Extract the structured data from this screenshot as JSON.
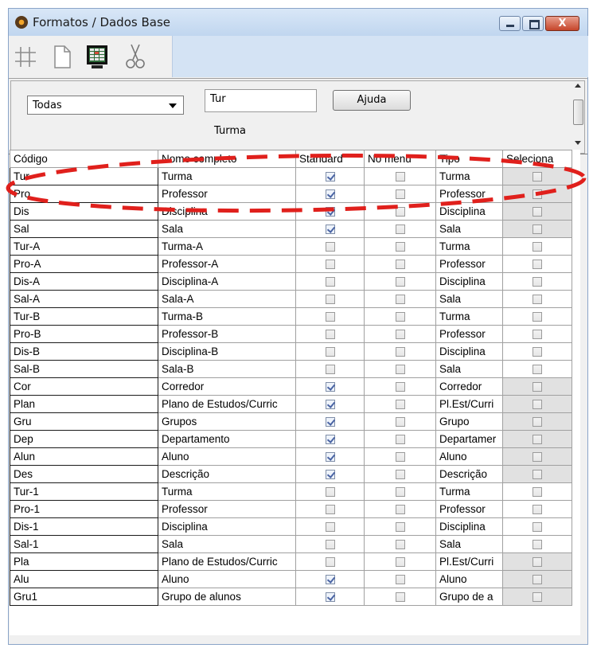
{
  "window": {
    "title": "Formatos / Dados Base",
    "close_label": "X"
  },
  "toolbar": {
    "tools": [
      "grid-icon",
      "new-document-icon",
      "table-view-icon",
      "cut-icon"
    ]
  },
  "filters": {
    "dropdown_value": "Todas",
    "input_value": "Tur",
    "help_button": "Ajuda",
    "full_name_label": "Turma"
  },
  "grid": {
    "columns": [
      "Código",
      "Nome completo",
      "Standard",
      "No menu",
      "Tipo",
      "Seleciona"
    ],
    "rows": [
      {
        "code": "Tur",
        "name": "Turma",
        "standard": true,
        "nomenu": false,
        "tipo": "Turma",
        "sel_shaded": true
      },
      {
        "code": "Pro",
        "name": "Professor",
        "standard": true,
        "nomenu": false,
        "tipo": "Professor",
        "sel_shaded": true
      },
      {
        "code": "Dis",
        "name": "Disciplina",
        "standard": true,
        "nomenu": false,
        "tipo": "Disciplina",
        "sel_shaded": true
      },
      {
        "code": "Sal",
        "name": "Sala",
        "standard": true,
        "nomenu": false,
        "tipo": "Sala",
        "sel_shaded": true
      },
      {
        "code": "Tur-A",
        "name": "Turma-A",
        "standard": false,
        "nomenu": false,
        "tipo": "Turma",
        "sel_shaded": false
      },
      {
        "code": "Pro-A",
        "name": "Professor-A",
        "standard": false,
        "nomenu": false,
        "tipo": "Professor",
        "sel_shaded": false
      },
      {
        "code": "Dis-A",
        "name": "Disciplina-A",
        "standard": false,
        "nomenu": false,
        "tipo": "Disciplina",
        "sel_shaded": false
      },
      {
        "code": "Sal-A",
        "name": "Sala-A",
        "standard": false,
        "nomenu": false,
        "tipo": "Sala",
        "sel_shaded": false
      },
      {
        "code": "Tur-B",
        "name": "Turma-B",
        "standard": false,
        "nomenu": false,
        "tipo": "Turma",
        "sel_shaded": false
      },
      {
        "code": "Pro-B",
        "name": "Professor-B",
        "standard": false,
        "nomenu": false,
        "tipo": "Professor",
        "sel_shaded": false
      },
      {
        "code": "Dis-B",
        "name": "Disciplina-B",
        "standard": false,
        "nomenu": false,
        "tipo": "Disciplina",
        "sel_shaded": false
      },
      {
        "code": "Sal-B",
        "name": "Sala-B",
        "standard": false,
        "nomenu": false,
        "tipo": "Sala",
        "sel_shaded": false
      },
      {
        "code": "Cor",
        "name": "Corredor",
        "standard": true,
        "nomenu": false,
        "tipo": "Corredor",
        "sel_shaded": true
      },
      {
        "code": "Plan",
        "name": "Plano de Estudos/Curric",
        "standard": true,
        "nomenu": false,
        "tipo": "Pl.Est/Curri",
        "sel_shaded": true
      },
      {
        "code": "Gru",
        "name": "Grupos",
        "standard": true,
        "nomenu": false,
        "tipo": "Grupo",
        "sel_shaded": true
      },
      {
        "code": "Dep",
        "name": "Departamento",
        "standard": true,
        "nomenu": false,
        "tipo": "Departamer",
        "sel_shaded": true
      },
      {
        "code": "Alun",
        "name": "Aluno",
        "standard": true,
        "nomenu": false,
        "tipo": "Aluno",
        "sel_shaded": true
      },
      {
        "code": "Des",
        "name": "Descrição",
        "standard": true,
        "nomenu": false,
        "tipo": "Descrição",
        "sel_shaded": true
      },
      {
        "code": "Tur-1",
        "name": "Turma",
        "standard": false,
        "nomenu": false,
        "tipo": "Turma",
        "sel_shaded": false
      },
      {
        "code": "Pro-1",
        "name": "Professor",
        "standard": false,
        "nomenu": false,
        "tipo": "Professor",
        "sel_shaded": false
      },
      {
        "code": "Dis-1",
        "name": "Disciplina",
        "standard": false,
        "nomenu": false,
        "tipo": "Disciplina",
        "sel_shaded": false
      },
      {
        "code": "Sal-1",
        "name": "Sala",
        "standard": false,
        "nomenu": false,
        "tipo": "Sala",
        "sel_shaded": false
      },
      {
        "code": "Pla",
        "name": "Plano de Estudos/Curric",
        "standard": false,
        "nomenu": false,
        "tipo": "Pl.Est/Curri",
        "sel_shaded": true
      },
      {
        "code": "Alu",
        "name": "Aluno",
        "standard": true,
        "nomenu": false,
        "tipo": "Aluno",
        "sel_shaded": true
      },
      {
        "code": "Gru1",
        "name": "Grupo de alunos",
        "standard": true,
        "nomenu": false,
        "tipo": "Grupo de a",
        "sel_shaded": true
      }
    ]
  },
  "colors": {
    "titlebar": "#c8dcf2",
    "annotation": "#e0201c",
    "check": "#4a64a4"
  }
}
